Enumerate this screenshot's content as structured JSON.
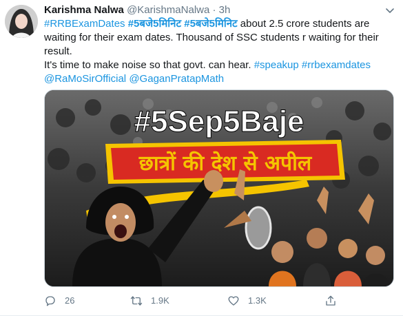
{
  "tweet": {
    "author": {
      "name": "Karishma Nalwa",
      "handle": "@KarishmaNalwa",
      "separator": "·",
      "time": "3h"
    },
    "text": {
      "hashtag_1": "#RRBExamDates",
      "hashtag_2": "#5बजे5मिनिट",
      "hashtag_3": "#5बजे5मिनिट",
      "line_1_rest": " about 2.5 crore students are waiting for their exam dates. Thousand of SSC students r waiting for their result.",
      "line_2_start": "It's time to make noise so that govt. can hear. ",
      "hashtag_4": "#speakup",
      "hashtag_5": "#rrbexamdates",
      "mention_1": "@RaMoSirOfficial",
      "mention_2": "@GaganPratapMath"
    },
    "media": {
      "headline": "#5Sep5Baje",
      "subline": "छात्रों की देश से अपील"
    },
    "actions": {
      "reply_count": "26",
      "retweet_count": "1.9K",
      "like_count": "1.3K"
    },
    "icons": [
      "avatar",
      "chevron-down-icon",
      "reply-icon",
      "retweet-icon",
      "like-icon",
      "share-icon"
    ],
    "colors": {
      "link": "#1b95e0",
      "muted": "#657786",
      "text": "#14171a",
      "banner_red": "#d92a22",
      "banner_yellow": "#f5c400"
    }
  }
}
